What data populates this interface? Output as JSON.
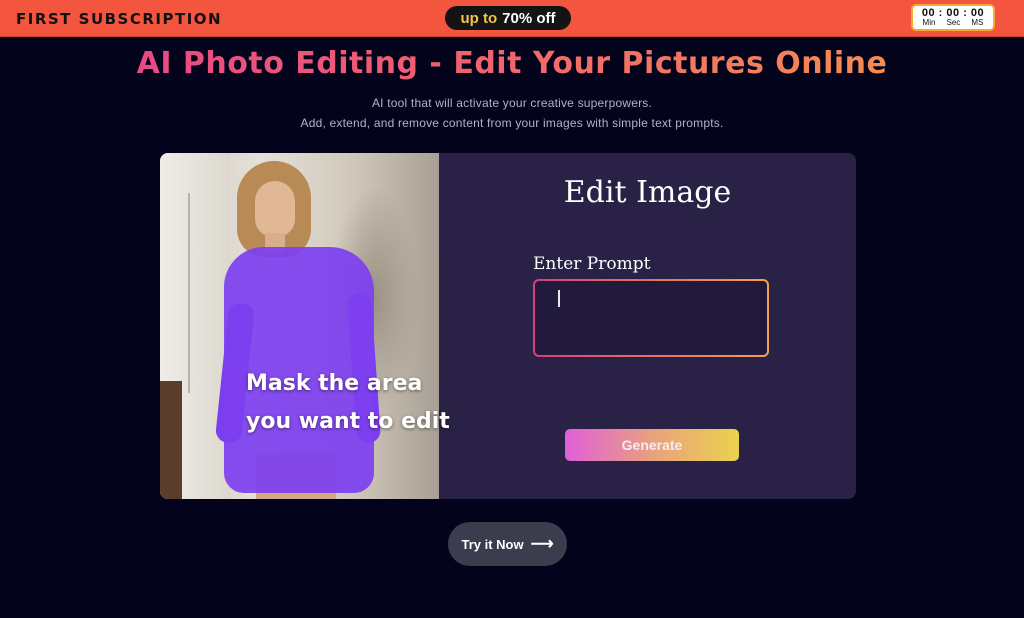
{
  "promo": {
    "title": "FIRST SUBSCRIPTION",
    "pill_prefix": "up to",
    "pill_discount": "70% off",
    "timer": {
      "value": "00 : 00 : 00",
      "units": [
        "Min",
        "Sec",
        "MS"
      ]
    }
  },
  "hero": {
    "headline": "AI Photo Editing - Edit Your Pictures Online",
    "subline_1": "AI tool that will activate your creative superpowers.",
    "subline_2": "Add, extend, and remove content from your images with simple text prompts."
  },
  "demo": {
    "mask_caption_line1": "Mask the area",
    "mask_caption_line2": "you want to edit",
    "form_title": "Edit Image",
    "prompt_label": "Enter Prompt",
    "prompt_value": "",
    "generate_label": "Generate"
  },
  "cta": {
    "label": "Try it Now",
    "arrow_icon": "arrow-right-icon"
  },
  "colors": {
    "background": "#04031c",
    "promo_bar": "#f3553f",
    "panel": "#2a2246",
    "mask": "#7d3ff0",
    "headline_gradient_start": "#e53f8e",
    "headline_gradient_end": "#f79a48"
  }
}
